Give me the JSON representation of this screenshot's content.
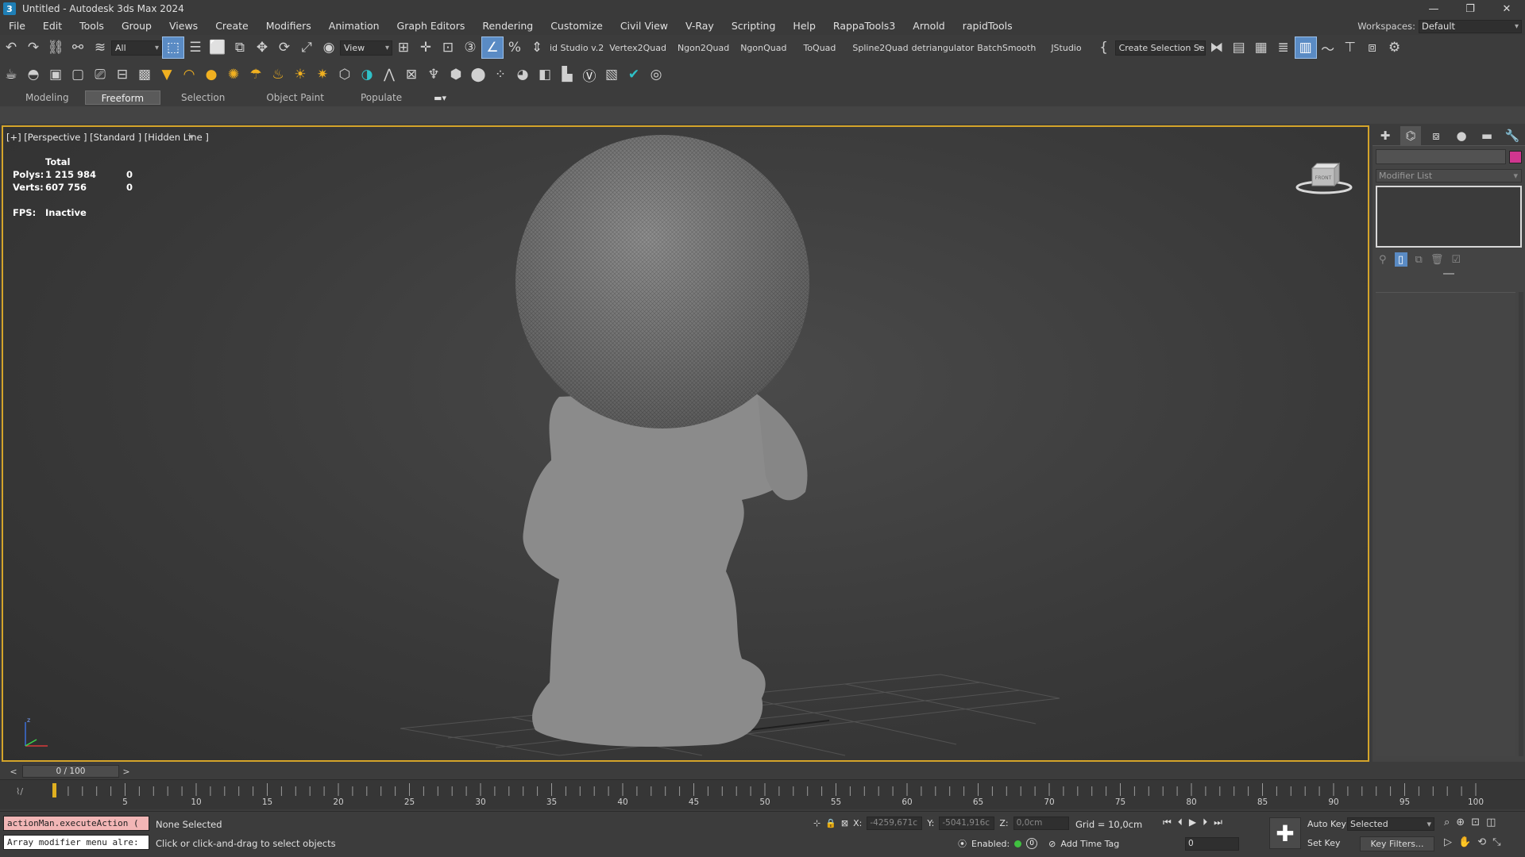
{
  "window": {
    "title": "Untitled - Autodesk 3ds Max 2024",
    "app_icon_letter": "3",
    "controls": [
      "—",
      "❐",
      "✕"
    ]
  },
  "menu": {
    "items": [
      "File",
      "Edit",
      "Tools",
      "Group",
      "Views",
      "Create",
      "Modifiers",
      "Animation",
      "Graph Editors",
      "Rendering",
      "Customize",
      "Civil View",
      "V-Ray",
      "Scripting",
      "Help",
      "RappaTools3",
      "Arnold",
      "rapidTools"
    ],
    "workspaces_label": "Workspaces:",
    "workspace_value": "Default"
  },
  "toolbar": {
    "selection_filter": "All",
    "ref_coord": "View",
    "script_buttons": [
      "id Studio v.2",
      "Vertex2Quad",
      "Ngon2Quad",
      "NgonQuad",
      "ToQuad",
      "Spline2Quad",
      "detriangulator",
      "BatchSmooth",
      "JStudio"
    ],
    "named_selection": "Create Selection Se"
  },
  "ribbon": {
    "tabs": [
      "Modeling",
      "Freeform",
      "Selection",
      "Object Paint",
      "Populate"
    ],
    "active_tab": "Freeform"
  },
  "viewport": {
    "label": "[+] [Perspective ] [Standard ] [Hidden Line ]",
    "stats": {
      "header": "Total",
      "polys_label": "Polys:",
      "polys_total": "1 215 984",
      "polys_selected": "0",
      "verts_label": "Verts:",
      "verts_total": "607 756",
      "verts_selected": "0",
      "fps_label": "FPS:",
      "fps_value": "Inactive"
    },
    "viewcube_face": "FRONT",
    "axis_z": "z"
  },
  "command_panel": {
    "modifier_list": "Modifier List",
    "object_color": "#d0368f"
  },
  "timeline": {
    "frame_display": "0 / 100",
    "ticks": [
      5,
      10,
      15,
      20,
      25,
      30,
      35,
      40,
      45,
      50,
      55,
      60,
      65,
      70,
      75,
      80,
      85,
      90,
      95,
      100
    ]
  },
  "status": {
    "maxscript_line1": "actionMan.executeAction (",
    "maxscript_line2": "Array modifier menu alre:",
    "selection_text": "None Selected",
    "prompt_text": "Click or click-and-drag to select objects",
    "x_label": "X:",
    "x_value": "-4259,671c",
    "y_label": "Y:",
    "y_value": "-5041,916c",
    "z_label": "Z:",
    "z_value": "0,0cm",
    "grid_text": "Grid = 10,0cm",
    "enabled_label": "Enabled:",
    "enabled_badge": "0",
    "add_time_tag": "Add Time Tag",
    "frame_value": "0",
    "auto_key": "Auto Key",
    "set_key": "Set Key",
    "key_mode": "Selected",
    "key_filters": "Key Filters..."
  },
  "colors": {
    "viewport_border": "#d4a42a",
    "active_tool": "#5a8bc4",
    "maxscript_error": "#f2b6b6"
  }
}
